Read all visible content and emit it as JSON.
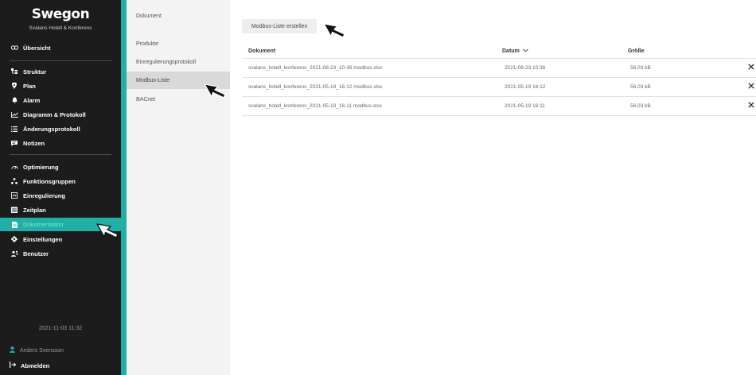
{
  "brand": {
    "logo": "Swegon",
    "subtitle": "Svalans Hotell & Konferens"
  },
  "sidebar": {
    "overview": {
      "label": "Übersicht",
      "icon": "overview-icon"
    },
    "items_group1": [
      {
        "label": "Struktur",
        "icon": "structure-icon"
      },
      {
        "label": "Plan",
        "icon": "location-pin-icon"
      },
      {
        "label": "Alarm",
        "icon": "bell-icon"
      },
      {
        "label": "Diagramm & Protokoll",
        "icon": "chart-icon"
      },
      {
        "label": "Änderungsprotokoll",
        "icon": "list-icon"
      },
      {
        "label": "Notizen",
        "icon": "note-icon"
      }
    ],
    "items_group2": [
      {
        "label": "Optimierung",
        "icon": "gauge-icon"
      },
      {
        "label": "Funktionsgruppen",
        "icon": "group-icon"
      },
      {
        "label": "Einregulierung",
        "icon": "balancing-icon"
      },
      {
        "label": "Zeitplan",
        "icon": "calendar-icon"
      },
      {
        "label": "Dokumentation",
        "icon": "document-icon",
        "active": true
      },
      {
        "label": "Einstellungen",
        "icon": "gear-icon"
      },
      {
        "label": "Benutzer",
        "icon": "users-icon"
      }
    ],
    "timestamp": "2021-11-03 11:32",
    "user": "Anders Svensson",
    "logout": "Abmelden"
  },
  "submenu": {
    "items": [
      {
        "label": "Dokument"
      },
      {
        "label": "Produkte"
      },
      {
        "label": "Einregulierungsprotokoll"
      },
      {
        "label": "Modbus-Liste",
        "active": true
      },
      {
        "label": "BACnet"
      }
    ]
  },
  "main": {
    "create_button": "Modbus-Liste erstellen",
    "columns": {
      "document": "Dokument",
      "date": "Datum",
      "size": "Größe"
    },
    "rows": [
      {
        "document": "svalans_hotell_konferens_2021-08-23_10-36 modbus.xlsx",
        "date": "2021-08-23 10:36",
        "size": "56.03 kB"
      },
      {
        "document": "svalans_hotell_konferens_2021-05-19_16-12 modbus.xlsx",
        "date": "2021-05-19 16:12",
        "size": "56.03 kB"
      },
      {
        "document": "svalans_hotell_konferens_2021-05-19_16-11 modbus.xlsx",
        "date": "2021-05-19 16:11",
        "size": "56.03 kB"
      }
    ]
  },
  "colors": {
    "accent": "#1fb0a6",
    "sidebar_bg": "#1c1c1c",
    "submenu_bg": "#f3f3f3"
  }
}
